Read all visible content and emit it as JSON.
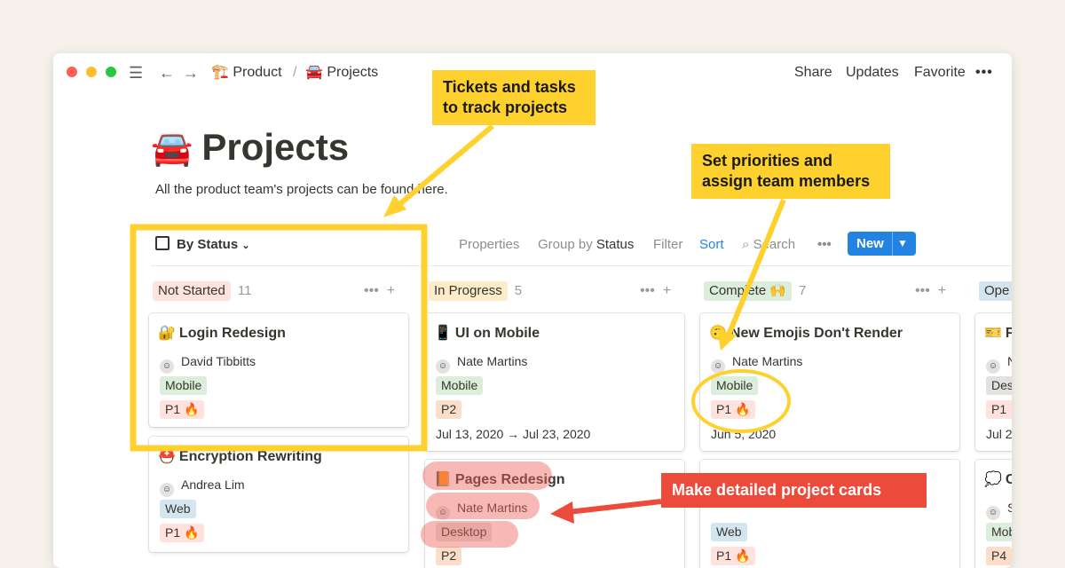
{
  "window": {
    "breadcrumb_parent": "Product",
    "breadcrumb_sep": "/",
    "breadcrumb_current": "Projects",
    "breadcrumb_parent_icon": "🏗️",
    "breadcrumb_current_icon": "🚘",
    "actions": [
      "Share",
      "Updates",
      "Favorite",
      "•••"
    ]
  },
  "page": {
    "title_icon": "🚘",
    "title": "Projects",
    "description": "All the product team's projects can be found here."
  },
  "viewbar": {
    "view_label": "By Status",
    "properties": "Properties",
    "group_by": "Group by",
    "group_by_value": "Status",
    "filter": "Filter",
    "sort": "Sort",
    "search": "Search",
    "more": "•••",
    "new_label": "New"
  },
  "columns": [
    {
      "label": "Not Started",
      "count": "11",
      "color": "#ffe2dd"
    },
    {
      "label": "In Progress",
      "count": "5",
      "color": "#fdecc8"
    },
    {
      "label": "Complete 🙌",
      "count": "7",
      "color": "#dbeddb"
    },
    {
      "label": "Ope",
      "count": "",
      "color": "#d3e5ef"
    }
  ],
  "cards": {
    "login": {
      "icon": "🔐",
      "title": "Login Redesign",
      "person": "David Tibbitts",
      "tag": "Mobile",
      "priority": "P1 🔥"
    },
    "encryption": {
      "icon": "⛑️",
      "title": "Encryption Rewriting",
      "person": "Andrea Lim",
      "tag": "Web",
      "priority": "P1 🔥"
    },
    "ui_mobile": {
      "icon": "📱",
      "title": "UI on Mobile",
      "person": "Nate Martins",
      "tag": "Mobile",
      "priority": "P2",
      "date": "Jul 13, 2020 → Jul 23, 2020"
    },
    "pages": {
      "icon": "📙",
      "title": "Pages Redesign",
      "person": "Nate Martins",
      "tag": "Desktop",
      "priority": "P2"
    },
    "emojis": {
      "icon": "🙃",
      "title": "New Emojis Don't Render",
      "person": "Nate Martins",
      "tag": "Mobile",
      "priority": "P1 🔥",
      "date": "Jun 5, 2020"
    },
    "complete2": {
      "tag": "Web",
      "priority": "P1 🔥"
    },
    "open1": {
      "icon": "🎫",
      "title": "F",
      "person": "N",
      "tag": "Des",
      "priority": "P1 🔥",
      "date": "Jul 2"
    },
    "open2": {
      "icon": "💭",
      "title": "C",
      "person": "S",
      "tag": "Mob",
      "priority": "P4"
    }
  },
  "callouts": {
    "tickets": "Tickets and tasks\nto track projects",
    "priorities": "Set priorities and\nassign team members",
    "cards": "Make detailed project cards"
  }
}
